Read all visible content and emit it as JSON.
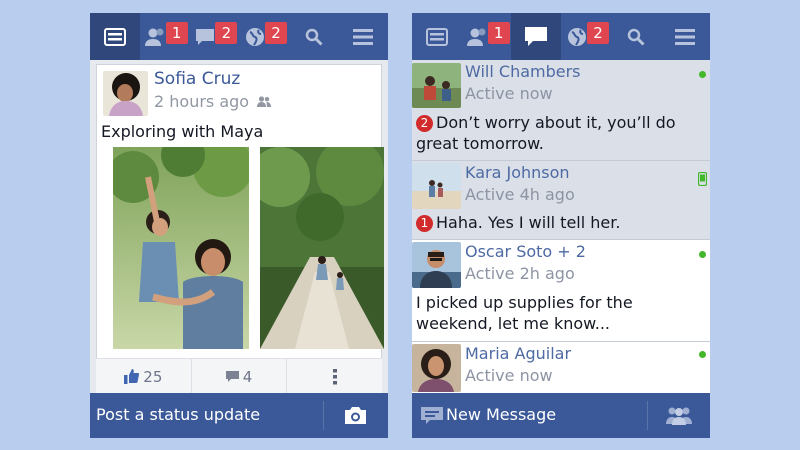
{
  "colors": {
    "brand": "#3b5998",
    "badge": "#e0464f",
    "online": "#42b72a",
    "background": "#b9cdef"
  },
  "left_screen": {
    "tabs": [
      {
        "icon": "news-feed-icon",
        "badge": "",
        "active": true
      },
      {
        "icon": "friend-requests-icon",
        "badge": "1"
      },
      {
        "icon": "messages-icon",
        "badge": "2"
      },
      {
        "icon": "notifications-globe-icon",
        "badge": "2"
      },
      {
        "icon": "search-icon",
        "badge": ""
      },
      {
        "icon": "menu-icon",
        "badge": ""
      }
    ],
    "post": {
      "author": "Sofia Cruz",
      "time": "2 hours ago",
      "privacy_icon": "friends-icon",
      "text": "Exploring with Maya",
      "like_count": "25",
      "comment_count": "4"
    },
    "bottom_bar": {
      "status_prompt": "Post a status update",
      "camera_icon": "camera-icon"
    }
  },
  "right_screen": {
    "tabs": [
      {
        "icon": "news-feed-icon",
        "badge": ""
      },
      {
        "icon": "friend-requests-icon",
        "badge": "1"
      },
      {
        "icon": "messages-icon",
        "badge": "",
        "active": true
      },
      {
        "icon": "notifications-globe-icon",
        "badge": "2"
      },
      {
        "icon": "search-icon",
        "badge": ""
      },
      {
        "icon": "menu-icon",
        "badge": ""
      }
    ],
    "conversations": [
      {
        "name": "Will Chambers",
        "status": "Active now",
        "unread_count": "2",
        "preview": "Don’t worry about it, you’ll do great tomorrow.",
        "presence": "online"
      },
      {
        "name": "Kara Johnson",
        "status": "Active 4h ago",
        "unread_count": "1",
        "preview": "Haha. Yes I will tell her.",
        "presence": "mobile"
      },
      {
        "name": "Oscar Soto + 2",
        "status": "Active 2h ago",
        "unread_count": "",
        "preview": "I picked up supplies for the weekend, let me know...",
        "presence": "online"
      },
      {
        "name": "Maria Aguilar",
        "status": "Active now",
        "unread_count": "",
        "preview": "",
        "presence": "online"
      }
    ],
    "bottom_bar": {
      "new_message_label": "New Message",
      "group_icon": "group-icon"
    }
  }
}
